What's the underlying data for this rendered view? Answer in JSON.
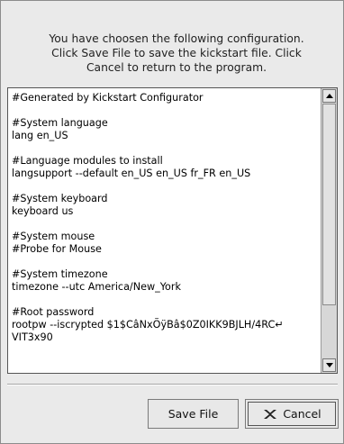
{
  "dialog": {
    "message": "You have choosen the following configuration.\nClick Save File to save the kickstart file. Click\nCancel to return to the program."
  },
  "config_text": "#Generated by Kickstart Configurator\n\n#System language\nlang en_US\n\n#Language modules to install\nlangsupport --default en_US en_US fr_FR en_US\n\n#System keyboard\nkeyboard us\n\n#System mouse\n#Probe for Mouse\n\n#System timezone\ntimezone --utc America/New_York\n\n#Root password\nrootpw --iscrypted $1$CâNxÕÿBâ$0Z0IKK9BJLH/4RC↵\nVIT3x90",
  "buttons": {
    "save": "Save File",
    "cancel": "Cancel"
  },
  "icons": {
    "cancel": "x-icon",
    "scroll_up": "up-arrow-icon",
    "scroll_down": "down-arrow-icon"
  }
}
